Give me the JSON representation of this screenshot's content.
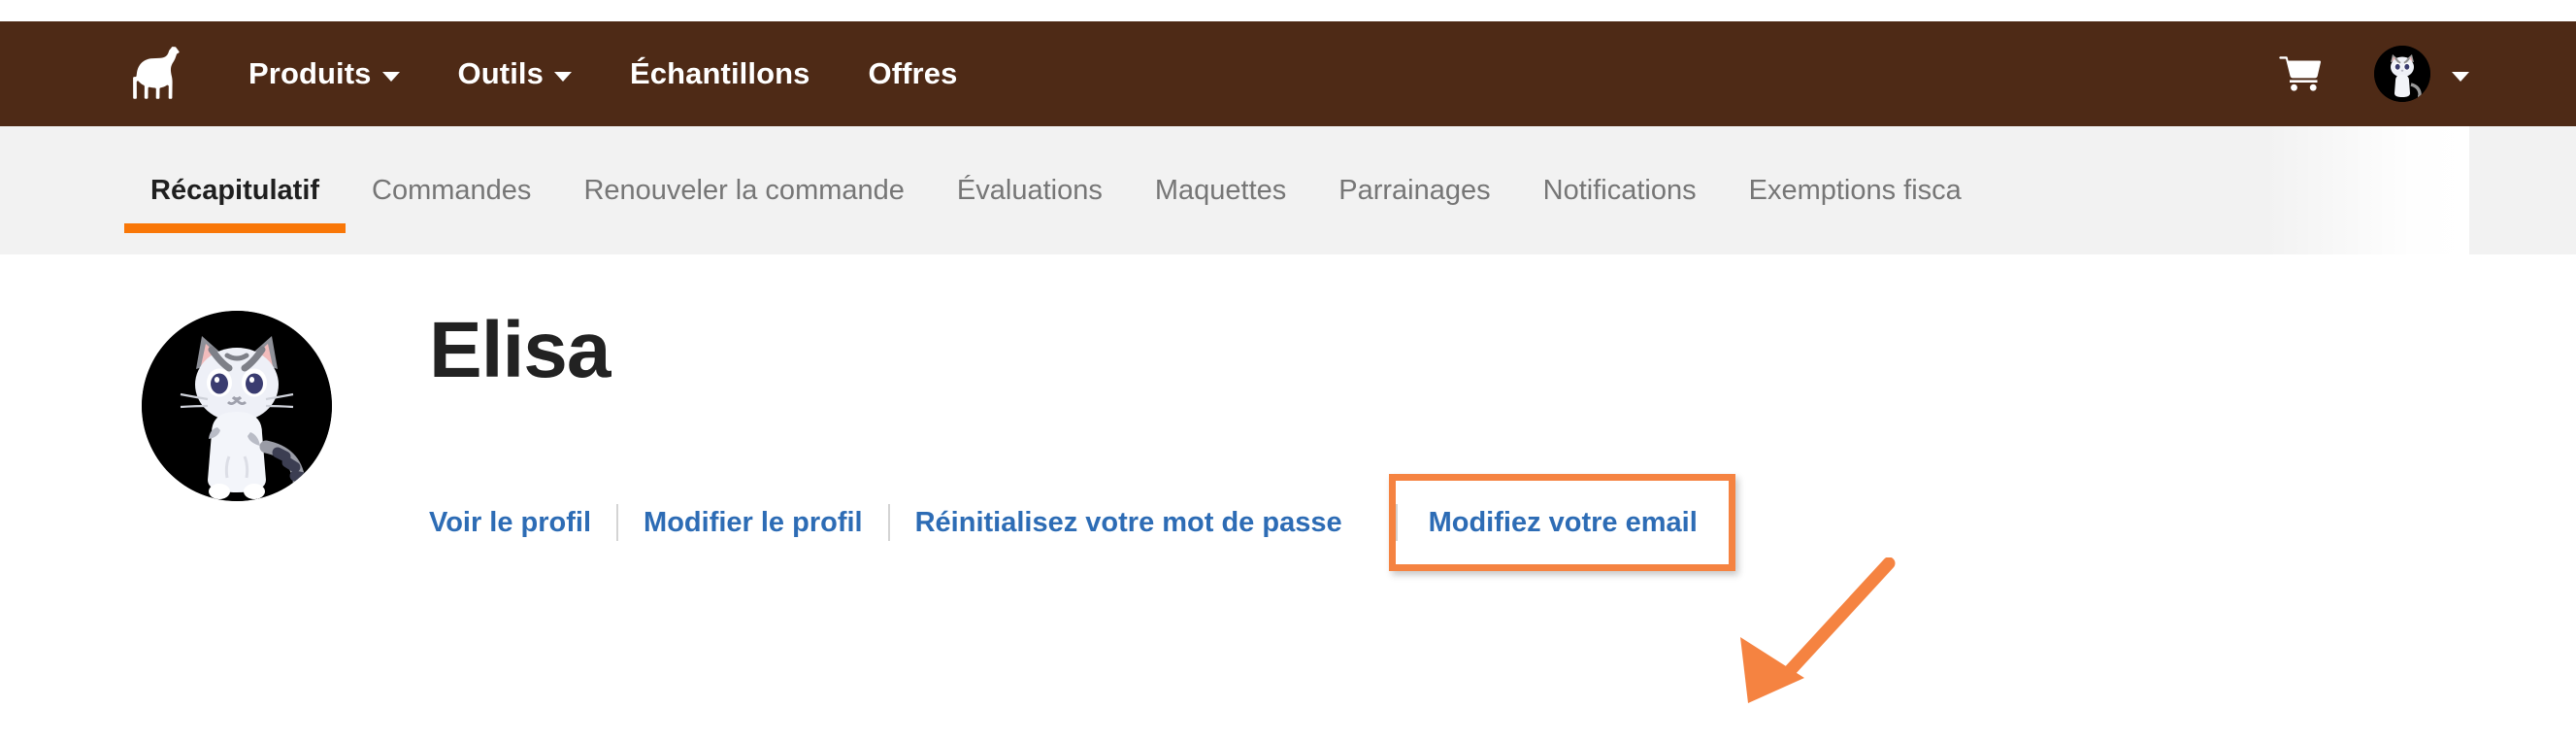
{
  "header": {
    "brand_icon": "horse-logo-icon",
    "nav_items": [
      {
        "label": "Produits",
        "has_dropdown": true
      },
      {
        "label": "Outils",
        "has_dropdown": true
      },
      {
        "label": "Échantillons",
        "has_dropdown": false
      },
      {
        "label": "Offres",
        "has_dropdown": false
      }
    ],
    "cart_icon": "shopping-cart-icon",
    "account_avatar": "cat-avatar-icon",
    "account_caret": "chevron-down-icon",
    "background_color": "#4E2A16"
  },
  "tabs": {
    "active_index": 0,
    "active_underline_color": "#F97707",
    "items": [
      {
        "label": "Récapitulatif"
      },
      {
        "label": "Commandes"
      },
      {
        "label": "Renouveler la commande"
      },
      {
        "label": "Évaluations"
      },
      {
        "label": "Maquettes"
      },
      {
        "label": "Parrainages"
      },
      {
        "label": "Notifications"
      },
      {
        "label": "Exemptions fisca"
      }
    ]
  },
  "profile": {
    "avatar": "cat-avatar-large",
    "name": "Elisa",
    "subline": "",
    "links": [
      {
        "label": "Voir le profil",
        "highlighted": false
      },
      {
        "label": "Modifier le profil",
        "highlighted": false
      },
      {
        "label": "Réinitialisez votre mot de passe",
        "highlighted": false
      },
      {
        "label": "Modifiez votre email",
        "highlighted": true
      }
    ],
    "link_color": "#2D6CB5"
  },
  "annotations": {
    "highlight_color": "#F58341",
    "arrow": "down-left-arrow-annotation",
    "box_target": "Modifiez votre email"
  }
}
